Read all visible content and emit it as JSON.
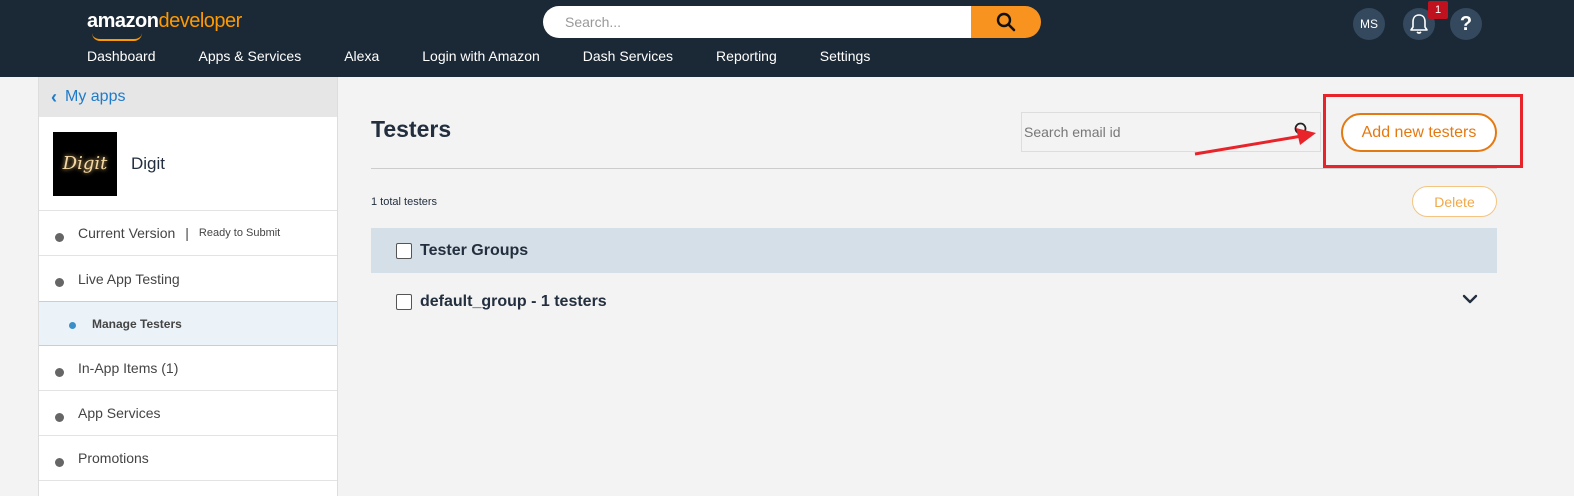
{
  "header": {
    "logo_amazon": "amazon",
    "logo_developer": "developer",
    "search_placeholder": "Search...",
    "nav": [
      "Dashboard",
      "Apps & Services",
      "Alexa",
      "Login with Amazon",
      "Dash Services",
      "Reporting",
      "Settings"
    ],
    "avatar_initials": "MS",
    "notification_count": "1",
    "help_label": "?"
  },
  "sidebar": {
    "back_label": "My apps",
    "app_name": "Digit",
    "app_icon_text": "Digit",
    "items": [
      {
        "label": "Current Version",
        "status": "Ready to Submit"
      },
      {
        "label": "Live App Testing"
      },
      {
        "label": "Manage Testers"
      },
      {
        "label": "In-App Items (1)"
      },
      {
        "label": "App Services"
      },
      {
        "label": "Promotions"
      }
    ]
  },
  "main": {
    "title": "Testers",
    "email_search_placeholder": "Search email id",
    "add_button": "Add new testers",
    "total_testers": "1 total testers",
    "delete_button": "Delete",
    "group_header": "Tester Groups",
    "groups": [
      {
        "label": "default_group - 1 testers"
      }
    ]
  },
  "colors": {
    "header_bg": "#1b2936",
    "accent": "#e47911",
    "annotation": "#e8232a"
  }
}
